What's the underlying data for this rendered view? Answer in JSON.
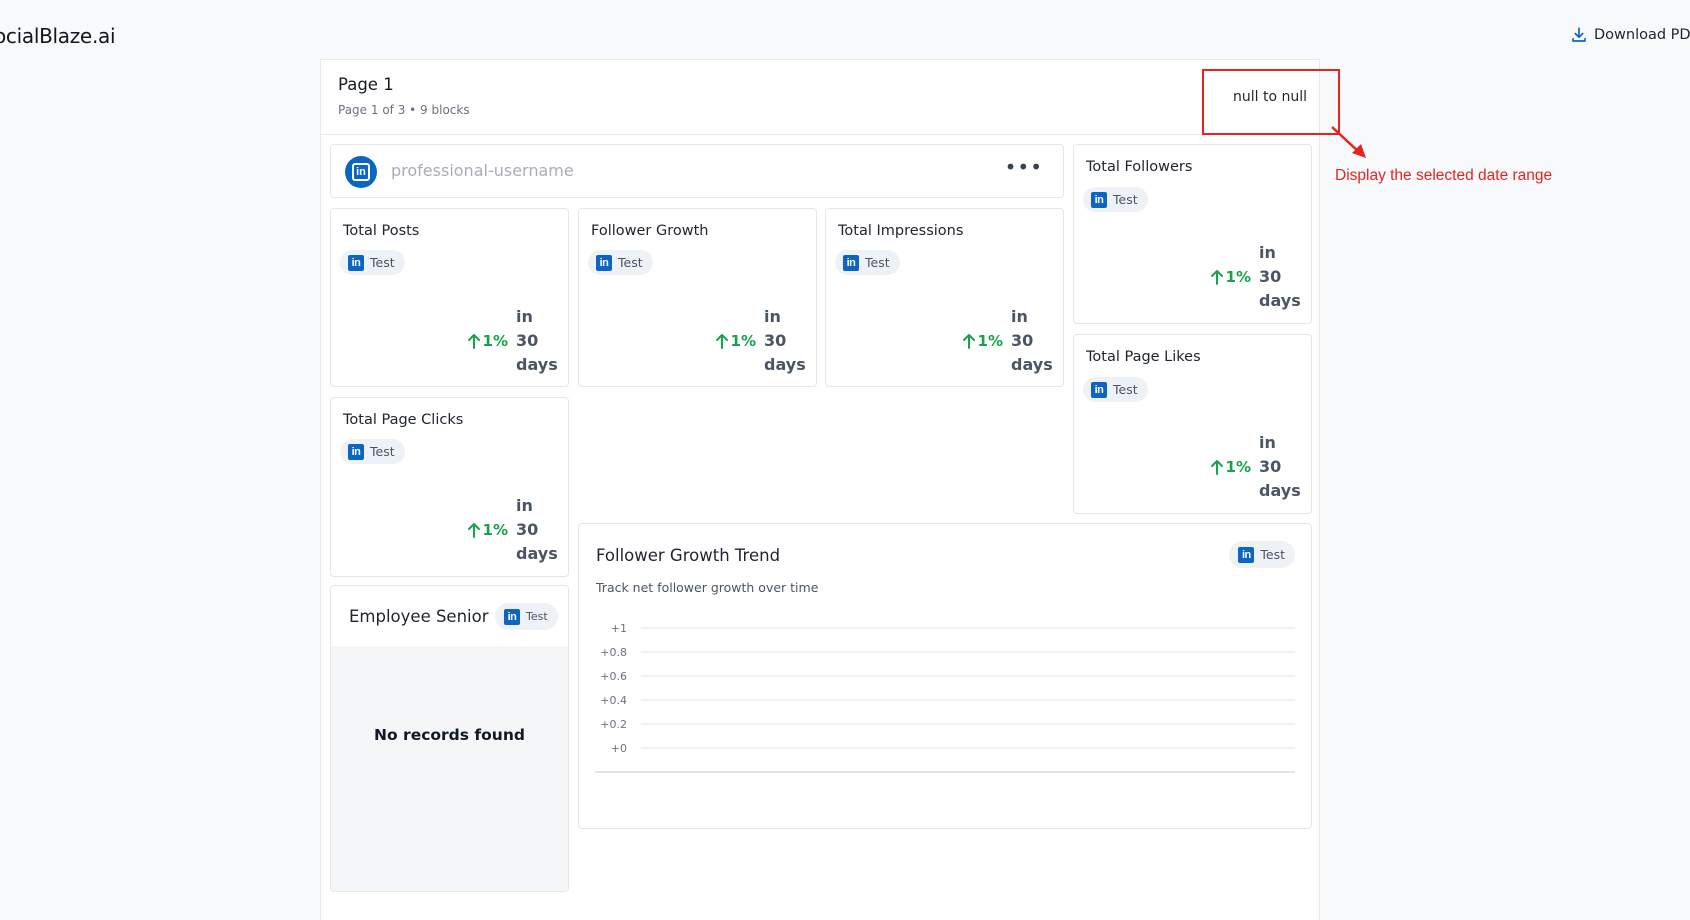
{
  "header": {
    "logo": "ocialBlaze.ai",
    "download_label": "Download PD"
  },
  "page": {
    "title": "Page 1",
    "subtitle": "Page 1 of 3 • 9 blocks",
    "date_range": "null to null"
  },
  "annotation": {
    "text": "Display the selected date range",
    "color": "#e8231f"
  },
  "profile": {
    "username": "professional-username",
    "more": "•••"
  },
  "platform_chip": "Test",
  "platform_icon": "linkedin-icon",
  "metrics": [
    {
      "title": "Total Posts",
      "change": "1%",
      "period": "in 30 days"
    },
    {
      "title": "Follower Growth",
      "change": "1%",
      "period": "in 30 days"
    },
    {
      "title": "Total Impressions",
      "change": "1%",
      "period": "in 30 days"
    },
    {
      "title": "Total Followers",
      "change": "1%",
      "period": "in 30 days"
    },
    {
      "title": "Total Page Clicks",
      "change": "1%",
      "period": "in 30 days"
    },
    {
      "title": "Total Page Likes",
      "change": "1%",
      "period": "in 30 days"
    }
  ],
  "employee": {
    "title": "Employee Senior",
    "chip": "Test",
    "empty": "No records found"
  },
  "trend": {
    "title": "Follower Growth Trend",
    "subtitle": "Track net follower growth over time",
    "chip": "Test"
  },
  "chart_data": {
    "type": "line",
    "title": "Follower Growth Trend",
    "subtitle": "Track net follower growth over time",
    "series": [],
    "ylim": [
      0,
      1
    ],
    "yticks": [
      "+1",
      "+0.8",
      "+0.6",
      "+0.4",
      "+0.2",
      "+0"
    ],
    "grid": true
  },
  "colors": {
    "linkedin": "#0a66c2",
    "positive": "#16a34a",
    "accent_red": "#e8231f"
  }
}
